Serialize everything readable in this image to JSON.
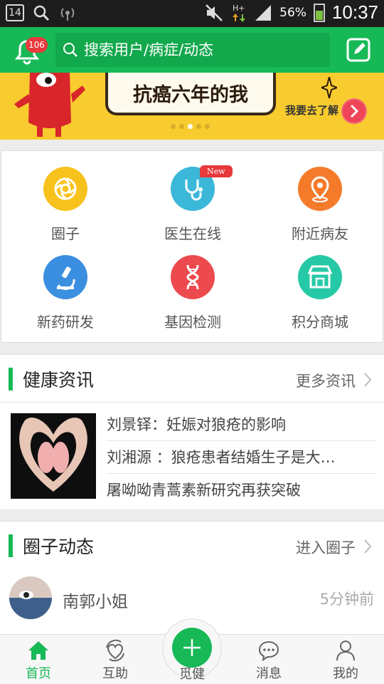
{
  "status_bar": {
    "notification_count": "14",
    "battery_percent": "56%",
    "time": "10:37"
  },
  "header": {
    "notification_badge": "106",
    "search_placeholder": "搜索用户/病症/动态"
  },
  "banner": {
    "headline": "抗癌六年的我",
    "cta": "我要去了解",
    "page_count": 5,
    "active_page": 3
  },
  "features": [
    {
      "label": "圈子",
      "icon": "aperture-icon",
      "color": "#f7c21c"
    },
    {
      "label": "医生在线",
      "icon": "stethoscope-icon",
      "color": "#3bb8d9",
      "tag": "New"
    },
    {
      "label": "附近病友",
      "icon": "location-pin-icon",
      "color": "#f57a2a"
    },
    {
      "label": "新药研发",
      "icon": "microscope-icon",
      "color": "#3b8fe0"
    },
    {
      "label": "基因检测",
      "icon": "dna-icon",
      "color": "#ec4a4e"
    },
    {
      "label": "积分商城",
      "icon": "store-icon",
      "color": "#26c9a6"
    }
  ],
  "health_news": {
    "title": "健康资讯",
    "more": "更多资讯",
    "items": [
      "刘景铎：妊娠对狼疮的影响",
      "刘湘源 ：狼疮患者结婚生子是大…",
      "屠呦呦青蒿素新研究再获突破"
    ]
  },
  "circle_feed": {
    "title": "圈子动态",
    "more": "进入圈子",
    "posts": [
      {
        "name": "南郭小姐",
        "time": "5分钟前"
      }
    ]
  },
  "tabs": [
    {
      "label": "首页",
      "icon": "home-icon",
      "active": true
    },
    {
      "label": "互助",
      "icon": "heart-cycle-icon",
      "active": false
    },
    {
      "label": "觅健",
      "icon": "plus-icon",
      "active": false
    },
    {
      "label": "消息",
      "icon": "chat-bubble-icon",
      "active": false
    },
    {
      "label": "我的",
      "icon": "person-icon",
      "active": false
    }
  ],
  "colors": {
    "brand_green": "#17b957",
    "banner_yellow": "#f8cc2f",
    "badge_red": "#e8393d"
  }
}
